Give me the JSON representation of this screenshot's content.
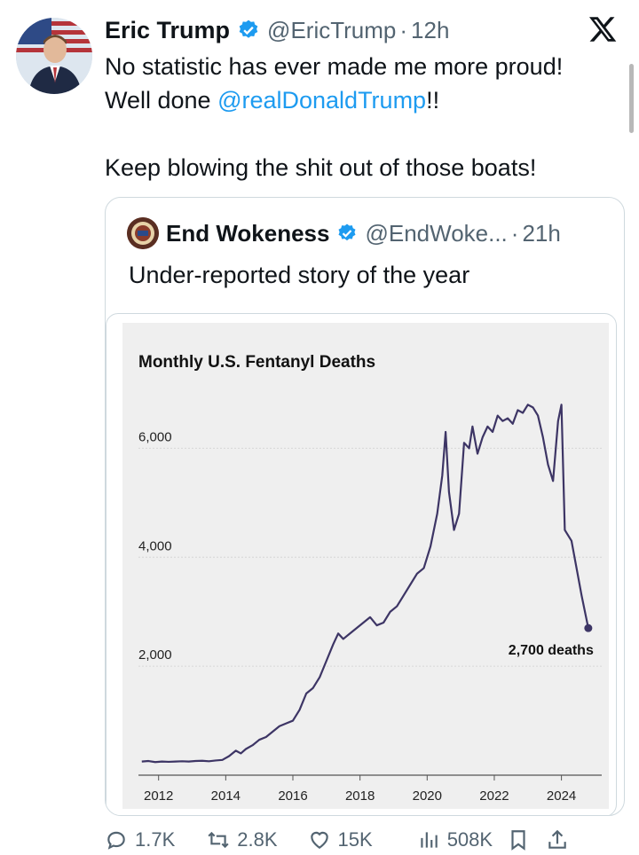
{
  "tweet": {
    "author_name": "Eric Trump",
    "handle": "@EricTrump",
    "separator": "·",
    "time": "12h",
    "line1": "No statistic has ever made me more proud!",
    "line2_prefix": "Well done ",
    "line2_mention": "@realDonaldTrump",
    "line2_suffix": "!!",
    "line3": "Keep blowing the shit out of those boats!"
  },
  "quote": {
    "author_name": "End Wokeness",
    "handle": "@EndWoke...",
    "separator": "·",
    "time": "21h",
    "text": "Under-reported story of the year"
  },
  "actions": {
    "reply_count": "1.7K",
    "retweet_count": "2.8K",
    "like_count": "15K",
    "views_count": "508K"
  },
  "colors": {
    "accent": "#1d9bf0",
    "line": "#3d3565",
    "chart_bg": "#efefef",
    "muted": "#536471"
  },
  "chart_data": {
    "type": "line",
    "title": "Monthly U.S. Fentanyl Deaths",
    "xlabel": "",
    "ylabel": "",
    "xlim": [
      2011.4,
      2025.2
    ],
    "ylim": [
      0,
      7000
    ],
    "yticks": [
      2000,
      4000,
      6000
    ],
    "ytick_labels": [
      "2,000",
      "4,000",
      "6,000"
    ],
    "xticks": [
      2012,
      2014,
      2016,
      2018,
      2020,
      2022,
      2024
    ],
    "xtick_labels": [
      "2012",
      "2014",
      "2016",
      "2018",
      "2020",
      "2022",
      "2024"
    ],
    "grid": "horizontal",
    "annotation": {
      "text": "2,700 deaths",
      "x": 2024.8,
      "y": 2700
    },
    "series": [
      {
        "x": [
          2011.5,
          2011.7,
          2011.9,
          2012.1,
          2012.3,
          2012.5,
          2012.7,
          2012.9,
          2013.1,
          2013.3,
          2013.5,
          2013.7,
          2013.9,
          2014.1,
          2014.3,
          2014.45,
          2014.6,
          2014.8,
          2015.0,
          2015.2,
          2015.4,
          2015.6,
          2015.8,
          2016.0,
          2016.2,
          2016.4,
          2016.6,
          2016.8,
          2017.0,
          2017.2,
          2017.35,
          2017.5,
          2017.7,
          2017.9,
          2018.1,
          2018.3,
          2018.5,
          2018.7,
          2018.9,
          2019.1,
          2019.3,
          2019.5,
          2019.7,
          2019.9,
          2020.1,
          2020.3,
          2020.45,
          2020.55,
          2020.65,
          2020.8,
          2020.95,
          2021.1,
          2021.25,
          2021.35,
          2021.5,
          2021.65,
          2021.8,
          2021.95,
          2022.1,
          2022.25,
          2022.4,
          2022.55,
          2022.7,
          2022.85,
          2023.0,
          2023.15,
          2023.3,
          2023.45,
          2023.6,
          2023.75,
          2023.9,
          2024.0,
          2024.1,
          2024.2,
          2024.3,
          2024.45,
          2024.6,
          2024.8
        ],
        "y": [
          250,
          260,
          240,
          250,
          245,
          250,
          255,
          250,
          260,
          265,
          255,
          270,
          280,
          350,
          450,
          400,
          480,
          550,
          650,
          700,
          800,
          900,
          950,
          1000,
          1200,
          1500,
          1600,
          1800,
          2100,
          2400,
          2600,
          2500,
          2600,
          2700,
          2800,
          2900,
          2750,
          2800,
          3000,
          3100,
          3300,
          3500,
          3700,
          3800,
          4200,
          4800,
          5500,
          6300,
          5200,
          4500,
          4800,
          6100,
          6000,
          6400,
          5900,
          6200,
          6400,
          6300,
          6600,
          6500,
          6550,
          6450,
          6700,
          6650,
          6800,
          6750,
          6600,
          6200,
          5700,
          5400,
          6500,
          6800,
          4500,
          4400,
          4300,
          3800,
          3300,
          2700
        ]
      }
    ]
  }
}
